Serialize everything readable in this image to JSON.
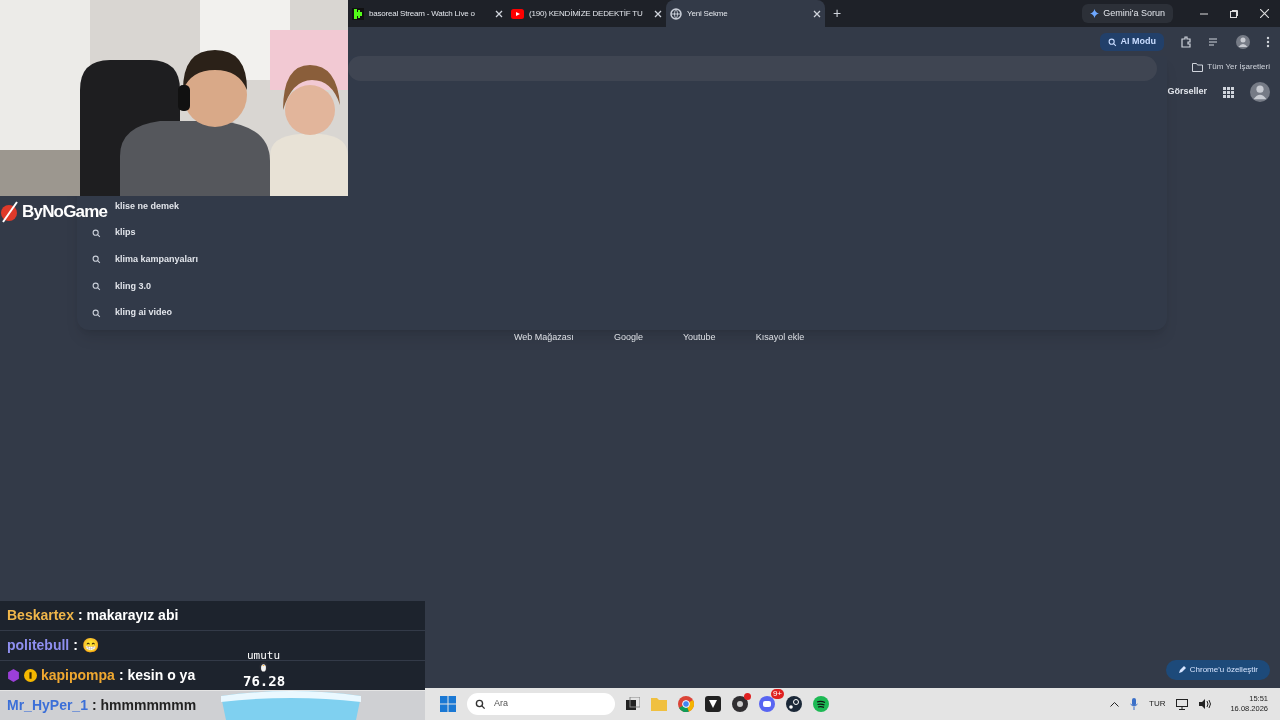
{
  "tabs": [
    {
      "title": "basoreal Stream - Watch Live o",
      "kind": "stream",
      "selected": false
    },
    {
      "title": "(190) KENDİMİZE DEDEKTİF TU",
      "kind": "video",
      "selected": false
    },
    {
      "title": "Yeni Sekme",
      "kind": "newtab",
      "selected": true
    }
  ],
  "new_tab": "+",
  "gemini_button": "Gemini'a Sorun",
  "ai_mode_button": "AI Modu",
  "bookmarks": "Tüm Yer İşaretleri",
  "images_link": "Görseller",
  "suggestions": [
    "klise ne demek",
    "klips",
    "klima kampanyaları",
    "kling 3.0",
    "kling ai video"
  ],
  "shortcuts": [
    "Web Mağazası",
    "Google",
    "Youtube",
    "Kısayol ekle"
  ],
  "customize_button": "Chrome'u özelleştir",
  "stream_logo": "ByNoGame",
  "chat": [
    {
      "user": "Beskartex",
      "color": "#f0b64a",
      "text": ": makarayız abi",
      "highlighted": false
    },
    {
      "user": "politebull",
      "color": "#8f8ff0",
      "text": ": 😁",
      "highlighted": false
    },
    {
      "user": "kapipompa",
      "color": "#f0a830",
      "text": ": kesin o ya",
      "badges": [
        {
          "kind": "cube"
        },
        {
          "kind": "coin"
        }
      ],
      "highlighted": false
    },
    {
      "user": "Mr_HyPer_1",
      "color": "#3b6fd8",
      "text": ": hmmmmmmm",
      "highlighted": true
    }
  ],
  "game_overlay": {
    "player": "umutu",
    "score": "76.28"
  },
  "taskbar": {
    "search_placeholder": "Ara",
    "discord_badge": "9+",
    "language": "TUR",
    "time": "15:51",
    "date": "16.08.2026"
  }
}
